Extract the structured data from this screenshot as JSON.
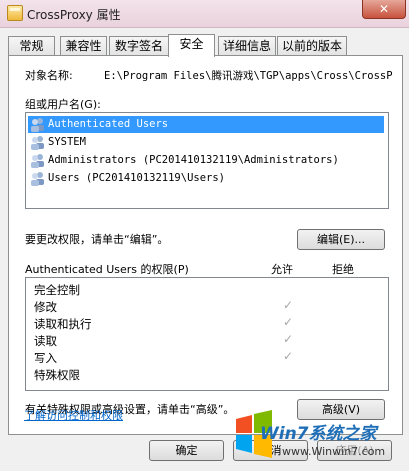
{
  "window": {
    "title": "CrossProxy 属性",
    "close": "✕"
  },
  "tabs": [
    {
      "label": "常规"
    },
    {
      "label": "兼容性"
    },
    {
      "label": "数字签名"
    },
    {
      "label": "安全"
    },
    {
      "label": "详细信息"
    },
    {
      "label": "以前的版本"
    }
  ],
  "security": {
    "object_label": "对象名称:",
    "object_path": "E:\\Program Files\\腾讯游戏\\TGP\\apps\\Cross\\CrossP",
    "groups_label": "组或用户名(G):",
    "groups": [
      {
        "name": "Authenticated Users"
      },
      {
        "name": "SYSTEM"
      },
      {
        "name": "Administrators (PC201410132119\\Administrators)"
      },
      {
        "name": "Users (PC201410132119\\Users)"
      }
    ],
    "change_hint": "要更改权限，请单击“编辑”。",
    "edit_button": "编辑(E)...",
    "perm_header": "Authenticated Users 的权限(P)",
    "allow_label": "允许",
    "deny_label": "拒绝",
    "permissions": [
      {
        "name": "完全控制",
        "allow": ""
      },
      {
        "name": "修改",
        "allow": "✓"
      },
      {
        "name": "读取和执行",
        "allow": "✓"
      },
      {
        "name": "读取",
        "allow": "✓"
      },
      {
        "name": "写入",
        "allow": "✓"
      },
      {
        "name": "特殊权限",
        "allow": ""
      }
    ],
    "advanced_hint": "有关特殊权限或高级设置，请单击“高级”。",
    "advanced_button": "高级(V)",
    "learn_link": "了解访问控制和权限"
  },
  "footer": {
    "ok_button": "确定",
    "cancel_button": "取消",
    "apply_button": "应用(A)"
  },
  "watermark": {
    "brand": "Win7系统之家",
    "url": "www.Winwin7.com"
  }
}
